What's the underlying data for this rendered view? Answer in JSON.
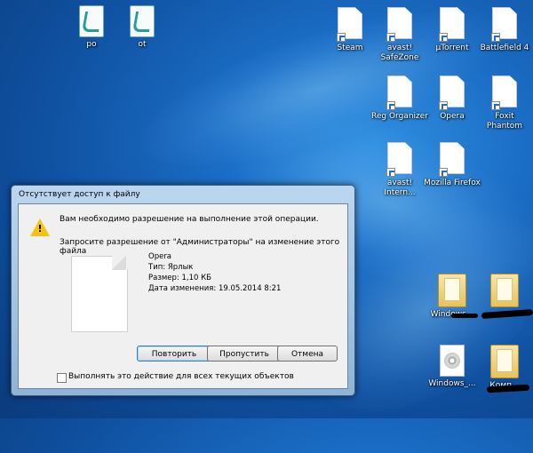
{
  "desktop": {
    "icons": [
      {
        "label": "po",
        "kind": "script"
      },
      {
        "label": "ot",
        "kind": "script"
      },
      {
        "label": "Steam",
        "kind": "shortcut"
      },
      {
        "label": "avast! SafeZone",
        "kind": "shortcut"
      },
      {
        "label": "µTorrent",
        "kind": "shortcut"
      },
      {
        "label": "Battlefield 4",
        "kind": "shortcut"
      },
      {
        "label": "Reg Organizer",
        "kind": "shortcut"
      },
      {
        "label": "Opera",
        "kind": "shortcut"
      },
      {
        "label": "Foxit Phantom",
        "kind": "shortcut"
      },
      {
        "label": "avast! Intern...",
        "kind": "shortcut"
      },
      {
        "label": "Mozilla Firefox",
        "kind": "shortcut"
      },
      {
        "label": "Windows...",
        "kind": "folder"
      },
      {
        "label": "",
        "kind": "folder"
      },
      {
        "label": "Windows_...",
        "kind": "disc"
      },
      {
        "label": "Комп...",
        "kind": "folder"
      }
    ]
  },
  "dialog": {
    "title": "Отсутствует доступ к файлу",
    "message": "Вам необходимо разрешение на выполнение этой операции.",
    "request": "Запросите разрешение от \"Администраторы\" на изменение этого файла",
    "file": {
      "name": "Opera",
      "type": "Тип: Ярлык",
      "size": "Размер: 1,10 КБ",
      "modified": "Дата изменения: 19.05.2014 8:21"
    },
    "buttons": {
      "retry": "Повторить",
      "skip": "Пропустить",
      "cancel": "Отмена"
    },
    "checkbox_label": "Выполнять это действие для всех текущих объектов"
  }
}
